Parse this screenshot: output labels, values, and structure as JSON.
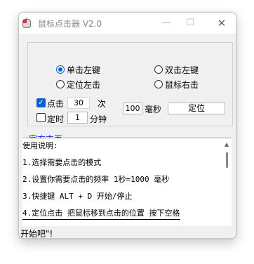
{
  "window": {
    "title": "鼠标点击器 V2.0",
    "controls": {
      "minimize": "—",
      "maximize": "☐",
      "close": "✕"
    }
  },
  "options": {
    "click_type": [
      {
        "label": "单击左键",
        "selected": true
      },
      {
        "label": "双击左键",
        "selected": false
      },
      {
        "label": "定位左击",
        "selected": false
      },
      {
        "label": "鼠标右击",
        "selected": false
      }
    ],
    "click_count": {
      "checked": true,
      "label": "点击",
      "value": "30",
      "unit": "次"
    },
    "interval": {
      "value": "100",
      "unit": "毫秒"
    },
    "locate_label": "定位",
    "timer": {
      "checked": false,
      "label": "定时",
      "value": "1",
      "unit": "分钟"
    }
  },
  "link": {
    "label": "官方主页"
  },
  "instructions": {
    "lines": [
      "使用说明:",
      "1.选择需要点击的模式",
      "2.设置你需要点击的频率 1秒=1000 毫秒",
      "3.快捷键 ALT + D 开始/停止",
      "4.定位点击 把鼠标移到点击的位置 按下空格"
    ]
  },
  "status": {
    "text": "开始吧\"!"
  },
  "colors": {
    "accent": "#0b5fd6",
    "link": "#1a2fd6",
    "window_bg": "#f0f0f0"
  }
}
